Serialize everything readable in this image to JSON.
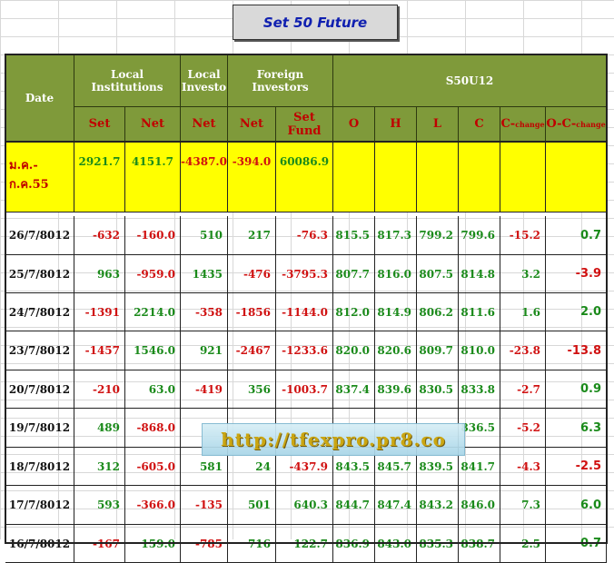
{
  "title": "Set 50  Future",
  "header": {
    "date": "Date",
    "local_institutions": "Local Institutions",
    "local_investors": "Local Investo",
    "foreign_investors": "Foreign Investors",
    "contract": "S50U12",
    "sub": {
      "set": "Set",
      "net1": "Net",
      "net2": "Net",
      "net3": "Net",
      "set_fund": "Set Fund",
      "o": "O",
      "h": "H",
      "l": "L",
      "c": "C",
      "c_change": "C-",
      "c_change_sub": "change",
      "oc_change": "O-C-",
      "oc_change_sub": "change"
    }
  },
  "summary": {
    "label": "ม.ค.-ก.ค.55",
    "set": "2921.7",
    "net1": "4151.7",
    "net2": "-4387.0",
    "net3": "-394.0",
    "set_fund": "60086.9"
  },
  "rows": [
    {
      "date": "26/7/8012",
      "set": "-632",
      "net1": "-160.0",
      "net2": "510",
      "net3": "217",
      "set_fund": "-76.3",
      "o": "815.5",
      "h": "817.3",
      "l": "799.2",
      "c": "799.6",
      "c_change": "-15.2",
      "oc_change": "0.7"
    },
    {
      "date": "25/7/8012",
      "set": "963",
      "net1": "-959.0",
      "net2": "1435",
      "net3": "-476",
      "set_fund": "-3795.3",
      "o": "807.7",
      "h": "816.0",
      "l": "807.5",
      "c": "814.8",
      "c_change": "3.2",
      "oc_change": "-3.9"
    },
    {
      "date": "24/7/8012",
      "set": "-1391",
      "net1": "2214.0",
      "net2": "-358",
      "net3": "-1856",
      "set_fund": "-1144.0",
      "o": "812.0",
      "h": "814.9",
      "l": "806.2",
      "c": "811.6",
      "c_change": "1.6",
      "oc_change": "2.0"
    },
    {
      "date": "23/7/8012",
      "set": "-1457",
      "net1": "1546.0",
      "net2": "921",
      "net3": "-2467",
      "set_fund": "-1233.6",
      "o": "820.0",
      "h": "820.6",
      "l": "809.7",
      "c": "810.0",
      "c_change": "-23.8",
      "oc_change": "-13.8"
    },
    {
      "date": "20/7/8012",
      "set": "-210",
      "net1": "63.0",
      "net2": "-419",
      "net3": "356",
      "set_fund": "-1003.7",
      "o": "837.4",
      "h": "839.6",
      "l": "830.5",
      "c": "833.8",
      "c_change": "-2.7",
      "oc_change": "0.9"
    },
    {
      "date": "19/7/8012",
      "set": "489",
      "net1": "-868.0",
      "net2": "",
      "net3": "",
      "set_fund": "",
      "o": "",
      "h": "",
      "l": "",
      "c": "836.5",
      "c_change": "-5.2",
      "oc_change": "6.3"
    },
    {
      "date": "18/7/8012",
      "set": "312",
      "net1": "-605.0",
      "net2": "581",
      "net3": "24",
      "set_fund": "-437.9",
      "o": "843.5",
      "h": "845.7",
      "l": "839.5",
      "c": "841.7",
      "c_change": "-4.3",
      "oc_change": "-2.5"
    },
    {
      "date": "17/7/8012",
      "set": "593",
      "net1": "-366.0",
      "net2": "-135",
      "net3": "501",
      "set_fund": "640.3",
      "o": "844.7",
      "h": "847.4",
      "l": "843.2",
      "c": "846.0",
      "c_change": "7.3",
      "oc_change": "6.0"
    },
    {
      "date": "16/7/8012",
      "set": "-167",
      "net1": "159.0",
      "net2": "-785",
      "net3": "716",
      "set_fund": "122.7",
      "o": "836.9",
      "h": "843.0",
      "l": "835.3",
      "c": "838.7",
      "c_change": "2.5",
      "oc_change": "0.7"
    }
  ],
  "watermark": "http://tfexpro.pr8.co",
  "colors": {
    "header_bg": "#7f9a3a",
    "summary_bg": "#ffff00",
    "positive": "#1a8a1a",
    "negative": "#d01010"
  }
}
